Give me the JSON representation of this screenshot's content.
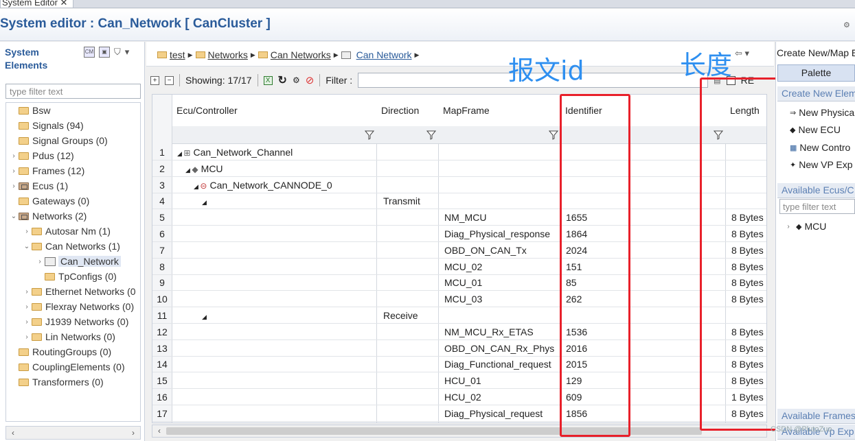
{
  "tab": {
    "label": "System Editor"
  },
  "title": "System editor : Can_Network [ CanCluster ]",
  "left": {
    "heading_line1": "System",
    "heading_line2": "Elements",
    "filter_placeholder": "type filter text",
    "tree": [
      {
        "label": "Bsw",
        "indent": 0,
        "twisty": "",
        "icon": "folder"
      },
      {
        "label": "Signals (94)",
        "indent": 0,
        "twisty": "",
        "icon": "folder"
      },
      {
        "label": "Signal Groups (0)",
        "indent": 0,
        "twisty": "",
        "icon": "folder"
      },
      {
        "label": "Pdus (12)",
        "indent": 0,
        "twisty": ">",
        "icon": "folder"
      },
      {
        "label": "Frames (12)",
        "indent": 0,
        "twisty": ">",
        "icon": "folder"
      },
      {
        "label": "Ecus (1)",
        "indent": 0,
        "twisty": ">",
        "icon": "folder"
      },
      {
        "label": "Gateways (0)",
        "indent": 0,
        "twisty": "",
        "icon": "folder"
      },
      {
        "label": "Networks (2)",
        "indent": 0,
        "twisty": "v",
        "icon": "folder"
      },
      {
        "label": "Autosar Nm (1)",
        "indent": 1,
        "twisty": ">",
        "icon": "folder"
      },
      {
        "label": "Can Networks (1)",
        "indent": 1,
        "twisty": "v",
        "icon": "folder"
      },
      {
        "label": "Can_Network",
        "indent": 2,
        "twisty": ">",
        "icon": "can",
        "selected": true
      },
      {
        "label": "TpConfigs (0)",
        "indent": 2,
        "twisty": "",
        "icon": "folder"
      },
      {
        "label": "Ethernet Networks (0",
        "indent": 1,
        "twisty": ">",
        "icon": "folder"
      },
      {
        "label": "Flexray Networks (0)",
        "indent": 1,
        "twisty": ">",
        "icon": "folder"
      },
      {
        "label": "J1939 Networks (0)",
        "indent": 1,
        "twisty": ">",
        "icon": "folder"
      },
      {
        "label": "Lin Networks (0)",
        "indent": 1,
        "twisty": ">",
        "icon": "folder"
      },
      {
        "label": "RoutingGroups (0)",
        "indent": 0,
        "twisty": "",
        "icon": "folder"
      },
      {
        "label": "CouplingElements (0)",
        "indent": 0,
        "twisty": "",
        "icon": "folder"
      },
      {
        "label": "Transformers (0)",
        "indent": 0,
        "twisty": "",
        "icon": "folder"
      }
    ]
  },
  "breadcrumb": [
    "test",
    "Networks",
    "Can Networks",
    "Can Network"
  ],
  "toolbar": {
    "showing": "Showing: 17/17",
    "filter_label": "Filter :",
    "re_label": "RE"
  },
  "grid": {
    "columns": [
      "Ecu/Controller",
      "Direction",
      "MapFrame",
      "Identifier",
      "Length"
    ],
    "rows": [
      {
        "n": "1",
        "ecu": "Can_Network_Channel",
        "ecu_level": 0,
        "dir": "",
        "frame": "",
        "id": "",
        "len": ""
      },
      {
        "n": "2",
        "ecu": "MCU",
        "ecu_level": 1,
        "dir": "",
        "frame": "",
        "id": "",
        "len": ""
      },
      {
        "n": "3",
        "ecu": "Can_Network_CANNODE_0",
        "ecu_level": 2,
        "dir": "",
        "frame": "",
        "id": "",
        "len": ""
      },
      {
        "n": "4",
        "ecu": "",
        "ecu_level": 3,
        "dir": "Transmit",
        "frame": "",
        "id": "",
        "len": ""
      },
      {
        "n": "5",
        "ecu": "",
        "ecu_level": -1,
        "dir": "",
        "frame": "NM_MCU",
        "id": "1655",
        "len": "8 Bytes"
      },
      {
        "n": "6",
        "ecu": "",
        "ecu_level": -1,
        "dir": "",
        "frame": "Diag_Physical_response",
        "id": "1864",
        "len": "8 Bytes"
      },
      {
        "n": "7",
        "ecu": "",
        "ecu_level": -1,
        "dir": "",
        "frame": "OBD_ON_CAN_Tx",
        "id": "2024",
        "len": "8 Bytes"
      },
      {
        "n": "8",
        "ecu": "",
        "ecu_level": -1,
        "dir": "",
        "frame": "MCU_02",
        "id": "151",
        "len": "8 Bytes"
      },
      {
        "n": "9",
        "ecu": "",
        "ecu_level": -1,
        "dir": "",
        "frame": "MCU_01",
        "id": "85",
        "len": "8 Bytes"
      },
      {
        "n": "10",
        "ecu": "",
        "ecu_level": -1,
        "dir": "",
        "frame": "MCU_03",
        "id": "262",
        "len": "8 Bytes"
      },
      {
        "n": "11",
        "ecu": "",
        "ecu_level": 3,
        "dir": "Receive",
        "frame": "",
        "id": "",
        "len": ""
      },
      {
        "n": "12",
        "ecu": "",
        "ecu_level": -1,
        "dir": "",
        "frame": "NM_MCU_Rx_ETAS",
        "id": "1536",
        "len": "8 Bytes"
      },
      {
        "n": "13",
        "ecu": "",
        "ecu_level": -1,
        "dir": "",
        "frame": "OBD_ON_CAN_Rx_Phys",
        "id": "2016",
        "len": "8 Bytes"
      },
      {
        "n": "14",
        "ecu": "",
        "ecu_level": -1,
        "dir": "",
        "frame": "Diag_Functional_request",
        "id": "2015",
        "len": "8 Bytes"
      },
      {
        "n": "15",
        "ecu": "",
        "ecu_level": -1,
        "dir": "",
        "frame": "HCU_01",
        "id": "129",
        "len": "8 Bytes"
      },
      {
        "n": "16",
        "ecu": "",
        "ecu_level": -1,
        "dir": "",
        "frame": "HCU_02",
        "id": "609",
        "len": "1 Bytes"
      },
      {
        "n": "17",
        "ecu": "",
        "ecu_level": -1,
        "dir": "",
        "frame": "Diag_Physical_request",
        "id": "1856",
        "len": "8 Bytes"
      }
    ]
  },
  "annotations": {
    "identifier_label": "报文id",
    "length_label": "长度",
    "color": "#e8202a",
    "text_color": "#2e8ff0"
  },
  "right": {
    "title": "Create New/Map E",
    "palette": "Palette",
    "create_section": "Create New Elem",
    "items": [
      "New Physica",
      "New ECU",
      "New Contro",
      "New VP Exp"
    ],
    "available_ecus": "Available Ecus/C",
    "filter_placeholder": "type filter text",
    "ecu_item": "MCU",
    "available_frames": "Available Frames",
    "available_vp": "Available Vp Exp"
  },
  "watermark": "CSDN @PlutoZuo"
}
